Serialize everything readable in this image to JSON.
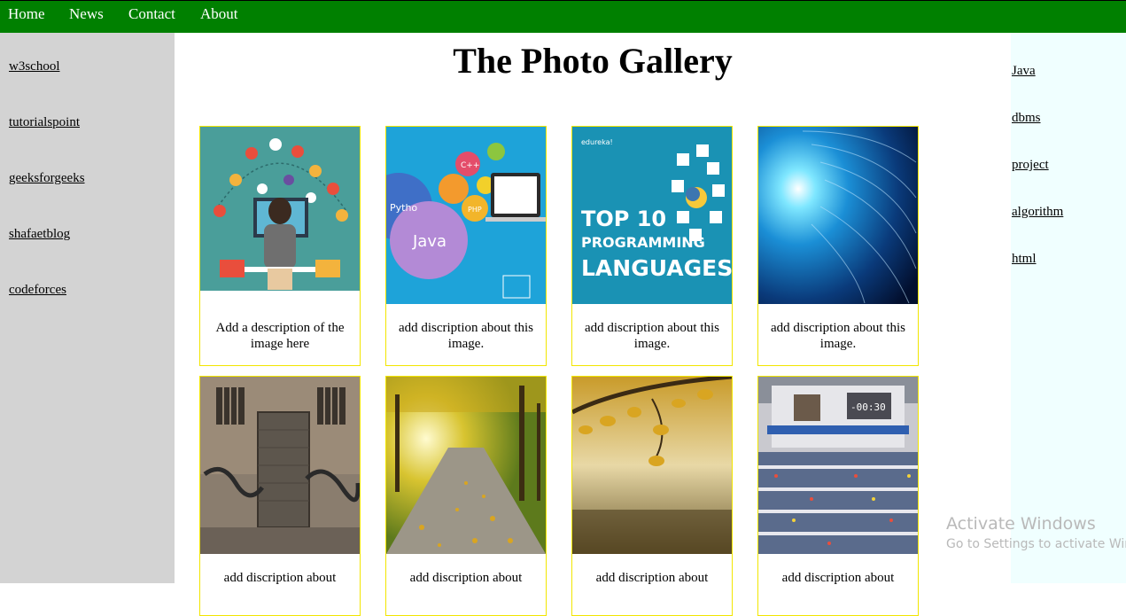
{
  "topnav": {
    "items": [
      "Home",
      "News",
      "Contact",
      "About"
    ],
    "color": "#008000"
  },
  "left_sidebar": {
    "links": [
      "w3school",
      "tutorialspoint",
      "geeksforgeeks",
      "shafaetblog",
      "codeforces"
    ]
  },
  "right_sidebar": {
    "links": [
      "Java",
      "dbms",
      "project",
      "algorithm",
      "html"
    ]
  },
  "main": {
    "title": "The Photo Gallery",
    "gallery": [
      {
        "image": "programmer-at-desk-illustration",
        "desc": "Add a description of the image here"
      },
      {
        "image": "java-python-cpp-bubbles-laptop",
        "desc": "add discription about this image."
      },
      {
        "image": "top-10-programming-languages-banner",
        "image_text": [
          "edureka!",
          "TOP 10",
          "PROGRAMMING",
          "LANGUAGES"
        ],
        "desc": "add discription about this image."
      },
      {
        "image": "blue-code-tunnel",
        "desc": "add discription about this image."
      },
      {
        "image": "graffiti-brick-garage",
        "desc": "add discription about"
      },
      {
        "image": "autumn-park-path",
        "desc": "add discription about"
      },
      {
        "image": "autumn-tree-branch",
        "desc": "add discription about"
      },
      {
        "image": "programming-contest-hall",
        "image_text": [
          "-00:30"
        ],
        "desc": "add discription about"
      }
    ]
  },
  "watermark": {
    "line1": "Activate Windows",
    "line2": "Go to Settings to activate Windows."
  }
}
